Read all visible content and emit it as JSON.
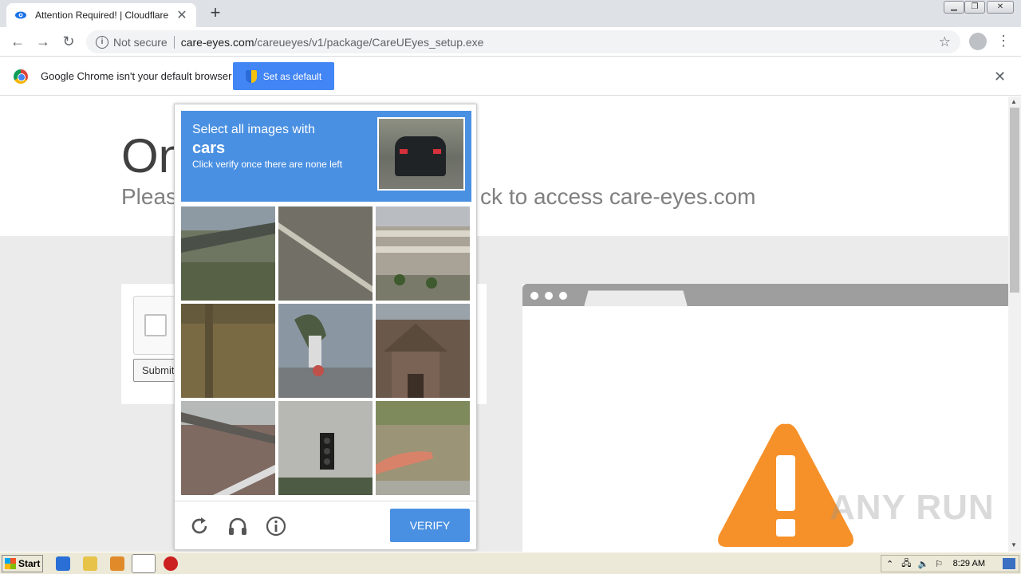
{
  "browser": {
    "tab_title": "Attention Required! | Cloudflare",
    "tab_close": "✕",
    "new_tab": "+",
    "url_security": "Not secure",
    "url_host": "care-eyes.com",
    "url_path": "/careueyes/v1/package/CareUEyes_setup.exe"
  },
  "infobar": {
    "message": "Google Chrome isn't your default browser",
    "button": "Set as default"
  },
  "page": {
    "heading_partial": "On",
    "subheading_left": "Pleas",
    "subheading_right": "ck to access care-eyes.com",
    "submit_label": "Submit"
  },
  "captcha": {
    "instruction": "Select all images with",
    "target": "cars",
    "hint": "Click verify once there are none left",
    "verify_label": "VERIFY",
    "tiles": [
      {
        "name": "tile-overpass-sign",
        "bg": "#6e7561"
      },
      {
        "name": "tile-road-line",
        "bg": "#727066"
      },
      {
        "name": "tile-parking-garage",
        "bg": "#a8a396"
      },
      {
        "name": "tile-wall-shadow",
        "bg": "#7a6a44"
      },
      {
        "name": "tile-palm-sign",
        "bg": "#8a97a3"
      },
      {
        "name": "tile-brick-house",
        "bg": "#6a584a"
      },
      {
        "name": "tile-bridge-road",
        "bg": "#7f6a62"
      },
      {
        "name": "tile-traffic-light",
        "bg": "#b7b8b3"
      },
      {
        "name": "tile-grass-curb",
        "bg": "#9b9476"
      }
    ]
  },
  "watermark": "ANY RUN",
  "taskbar": {
    "start_label": "Start",
    "clock": "8:29 AM"
  },
  "colors": {
    "captcha_blue": "#4a90e2",
    "chrome_blue": "#4285f4",
    "warning_orange": "#f6912a"
  }
}
